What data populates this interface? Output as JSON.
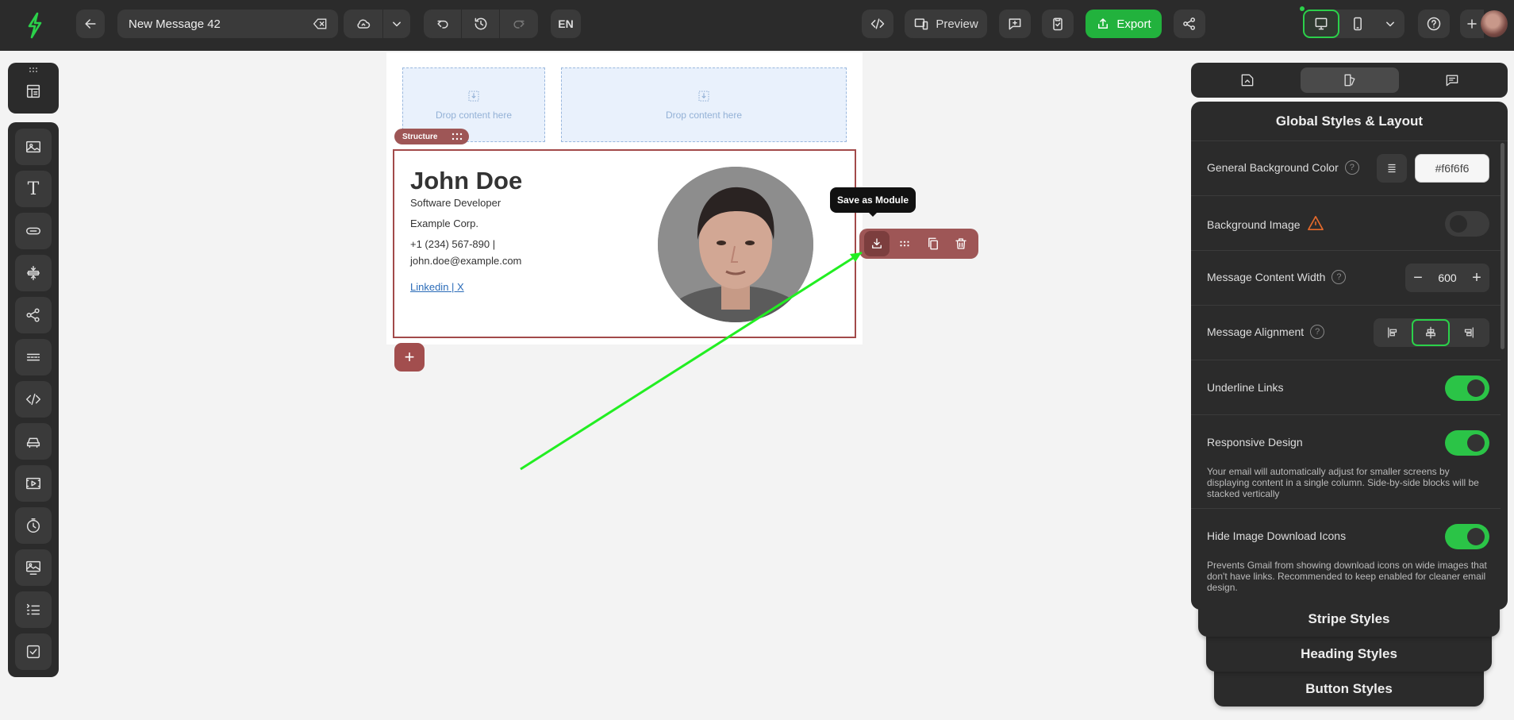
{
  "topbar": {
    "message_name": "New Message 42",
    "language": "EN",
    "preview_label": "Preview",
    "export_label": "Export"
  },
  "canvas": {
    "drop_left": "Drop content here",
    "drop_right": "Drop content here",
    "structure_tag": "Structure",
    "signature": {
      "name": "John Doe",
      "title": "Software Developer",
      "company": "Example Corp.",
      "phone": "+1 (234) 567-890 |",
      "email": "john.doe@example.com",
      "link_linkedin": "Linkedin",
      "link_separator": " | ",
      "link_x": "X"
    },
    "tooltip": "Save as Module",
    "add_row": "+"
  },
  "panel": {
    "title": "Global Styles & Layout",
    "bg_color_label": "General Background Color",
    "bg_color_value": "#f6f6f6",
    "bg_image_label": "Background Image",
    "bg_image_on": false,
    "content_width_label": "Message Content Width",
    "content_width_value": "600",
    "alignment_label": "Message Alignment",
    "alignment_selected": "center",
    "underline_label": "Underline Links",
    "underline_on": true,
    "responsive_label": "Responsive Design",
    "responsive_on": true,
    "responsive_desc": "Your email will automatically adjust for smaller screens by displaying content in a single column. Side-by-side blocks will be stacked vertically",
    "hide_icons_label": "Hide Image Download Icons",
    "hide_icons_on": true,
    "hide_icons_desc": "Prevents Gmail from showing download icons on wide images that don't have links. Recommended to keep enabled for cleaner email design.",
    "stacked_sections": [
      "Stripe Styles",
      "Heading Styles",
      "Button Styles"
    ]
  },
  "colors": {
    "accent_green": "#22b23d",
    "structure_red": "#9e5656",
    "annotation_arrow": "#22ee22"
  }
}
